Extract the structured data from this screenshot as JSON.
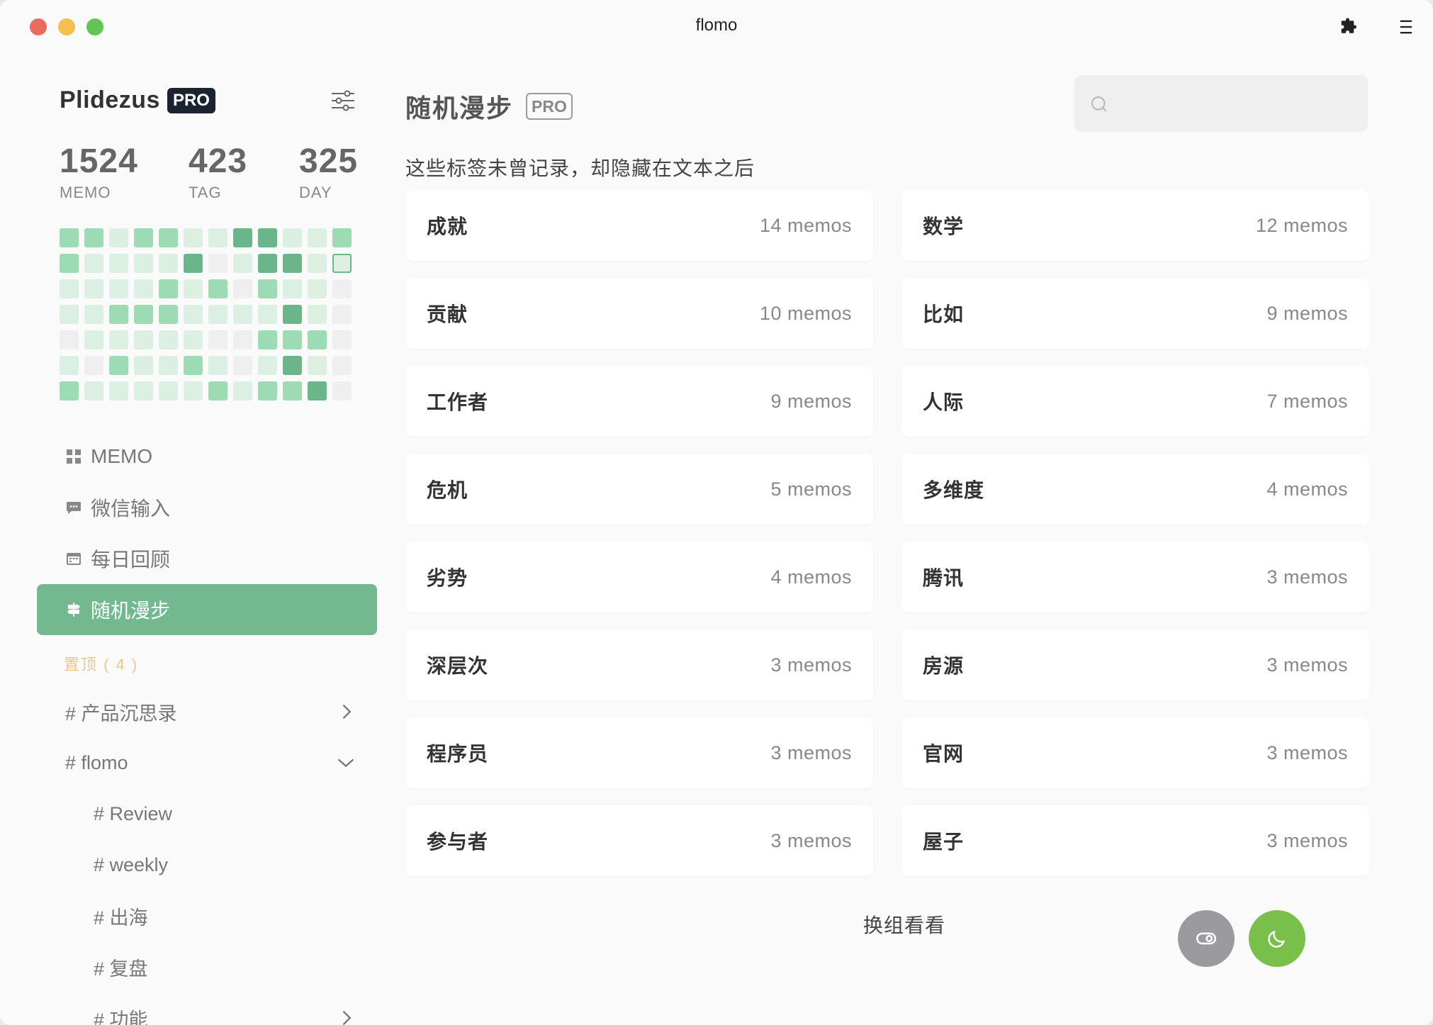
{
  "window": {
    "title": "flomo"
  },
  "user": {
    "name": "Plidezus",
    "badge": "PRO"
  },
  "stats": [
    {
      "value": "1524",
      "label": "MEMO"
    },
    {
      "value": "423",
      "label": "TAG"
    },
    {
      "value": "325",
      "label": "DAY"
    }
  ],
  "heatmap": {
    "levels": [
      [
        2,
        2,
        1,
        2,
        2,
        1,
        1,
        3,
        3,
        1,
        1,
        2
      ],
      [
        2,
        1,
        1,
        1,
        1,
        3,
        0,
        1,
        3,
        3,
        1,
        4
      ],
      [
        1,
        1,
        1,
        1,
        2,
        1,
        2,
        0,
        2,
        1,
        1,
        0
      ],
      [
        1,
        1,
        2,
        2,
        2,
        1,
        1,
        1,
        1,
        3,
        1,
        0
      ],
      [
        0,
        1,
        1,
        1,
        1,
        1,
        0,
        0,
        2,
        2,
        2,
        0
      ],
      [
        1,
        0,
        2,
        1,
        1,
        2,
        1,
        0,
        1,
        3,
        1,
        0
      ],
      [
        2,
        1,
        1,
        1,
        1,
        1,
        2,
        1,
        2,
        2,
        3,
        0
      ]
    ]
  },
  "nav": [
    {
      "label": "MEMO",
      "icon": "grid-icon",
      "active": false
    },
    {
      "label": "微信输入",
      "icon": "chat-icon",
      "active": false
    },
    {
      "label": "每日回顾",
      "icon": "calendar-icon",
      "active": false
    },
    {
      "label": "随机漫步",
      "icon": "signpost-icon",
      "active": true
    }
  ],
  "pinned": {
    "label": "置顶 ( 4 )"
  },
  "tags": [
    {
      "label": "# 产品沉思录",
      "level": 0,
      "chevron": "right"
    },
    {
      "label": "# flomo",
      "level": 0,
      "chevron": "down"
    },
    {
      "label": "# Review",
      "level": 1,
      "chevron": ""
    },
    {
      "label": "# weekly",
      "level": 1,
      "chevron": ""
    },
    {
      "label": "# 出海",
      "level": 1,
      "chevron": ""
    },
    {
      "label": "# 复盘",
      "level": 1,
      "chevron": ""
    },
    {
      "label": "# 功能",
      "level": 1,
      "chevron": "right"
    }
  ],
  "main": {
    "title": "随机漫步",
    "title_badge": "PRO",
    "search": {
      "placeholder": "",
      "value": ""
    },
    "subtitle": "这些标签未曾记录，却隐藏在文本之后",
    "cards": [
      {
        "name": "成就",
        "count": "14 memos"
      },
      {
        "name": "数学",
        "count": "12 memos"
      },
      {
        "name": "贡献",
        "count": "10 memos"
      },
      {
        "name": "比如",
        "count": "9 memos"
      },
      {
        "name": "工作者",
        "count": "9 memos"
      },
      {
        "name": "人际",
        "count": "7 memos"
      },
      {
        "name": "危机",
        "count": "5 memos"
      },
      {
        "name": "多维度",
        "count": "4 memos"
      },
      {
        "name": "劣势",
        "count": "4 memos"
      },
      {
        "name": "腾讯",
        "count": "3 memos"
      },
      {
        "name": "深层次",
        "count": "3 memos"
      },
      {
        "name": "房源",
        "count": "3 memos"
      },
      {
        "name": "程序员",
        "count": "3 memos"
      },
      {
        "name": "官网",
        "count": "3 memos"
      },
      {
        "name": "参与者",
        "count": "3 memos"
      },
      {
        "name": "屋子",
        "count": "3 memos"
      }
    ],
    "shuffle_label": "换组看看"
  },
  "colors": {
    "accent": "#72b98f",
    "heat_low": "#dcefe3",
    "heat_mid": "#9ddbb5",
    "heat_high": "#6bb58a",
    "fab_moon": "#79c04a",
    "fab_toggle": "#9a9a9f",
    "pinned": "#e6c98f"
  }
}
